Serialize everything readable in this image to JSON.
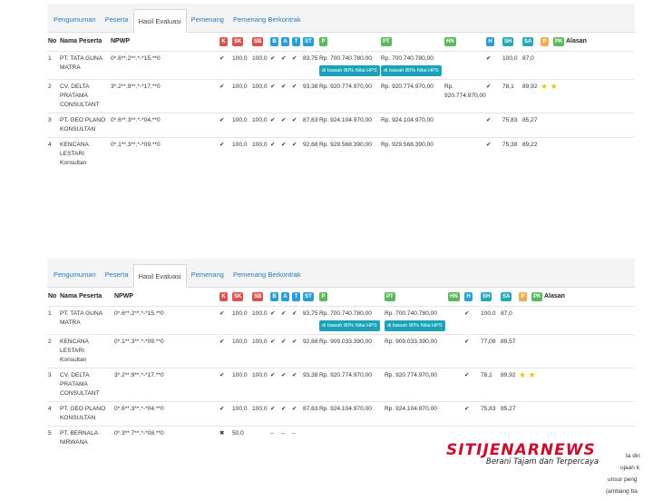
{
  "panels": [
    {
      "tabs": [
        "Pengumuman",
        "Peserta",
        "Hasil Evaluasi",
        "Pemenang",
        "Pemenang Berkontrak"
      ],
      "active_tab": 2,
      "rows": [
        {
          "no": "1",
          "nama": "PT. TATA GUNA MATRA",
          "npwp": "0*.6**.2**.*-*15.**0",
          "k": "✔",
          "sk": "100,0",
          "sb": "100,0",
          "b": "✔",
          "a": "✔",
          "t": "✔",
          "st": "83,75",
          "p": "Rp. 700.740.780,00",
          "pt": "Rp. 700.740.780,00",
          "hn": "",
          "h": "✔",
          "sh": "100,0",
          "sa": "87,0",
          "stars": "",
          "labels": [
            "di bawah 80% Nilai HPS",
            "di bawah 80% Nilai HPS"
          ]
        },
        {
          "no": "2",
          "nama": "CV. DELTA PRATAMA CONSULTANT",
          "npwp": "3*.2**.9**.*-*17.**0",
          "k": "✔",
          "sk": "100,0",
          "sb": "100,0",
          "b": "✔",
          "a": "✔",
          "t": "✔",
          "st": "93,38",
          "p": "Rp. 920.774.970,00",
          "pt": "Rp. 920.774.970,00",
          "hn": "Rp. 920.774.970,00",
          "h": "✔",
          "sh": "78,1",
          "sa": "89,92",
          "stars": "★ ★",
          "labels": []
        },
        {
          "no": "3",
          "nama": "PT. GEO PLANO KONSULTAN",
          "npwp": "0*.6**.3**.*-*04.**0",
          "k": "✔",
          "sk": "100,0",
          "sb": "100,0",
          "b": "✔",
          "a": "✔",
          "t": "✔",
          "st": "87,63",
          "p": "Rp. 924.104.970,00",
          "pt": "Rp. 924.104.970,00",
          "hn": "",
          "h": "✔",
          "sh": "75,83",
          "sa": "85,27",
          "stars": "",
          "labels": []
        },
        {
          "no": "4",
          "nama": "KENCANA LESTARI Konsultan",
          "npwp": "0*.1**.3**.*-*09.**0",
          "k": "✔",
          "sk": "100,0",
          "sb": "100,0",
          "b": "✔",
          "a": "✔",
          "t": "✔",
          "st": "92,68",
          "p": "Rp. 929.568.390,00",
          "pt": "Rp. 929.568.390,00",
          "hn": "",
          "h": "✔",
          "sh": "75,38",
          "sa": "89,22",
          "stars": "",
          "labels": []
        }
      ]
    },
    {
      "tabs": [
        "Pengumuman",
        "Peserta",
        "Hasil Evaluasi",
        "Pemenang",
        "Pemenang Berkontrak"
      ],
      "active_tab": 2,
      "rows": [
        {
          "no": "1",
          "nama": "PT. TATA GUNA MATRA",
          "npwp": "0*.6**.2**.*-*15.**0",
          "k": "✔",
          "sk": "100,0",
          "sb": "100,0",
          "b": "✔",
          "a": "✔",
          "t": "✔",
          "st": "83,75",
          "p": "Rp. 700.740.780,00",
          "pt": "Rp. 700.740.780,00",
          "hn": "",
          "h": "✔",
          "sh": "100,0",
          "sa": "87,0",
          "stars": "",
          "labels": [
            "di bawah 80% Nilai HPS",
            "di bawah 80% Nilai HPS"
          ]
        },
        {
          "no": "2",
          "nama": "KENCANA LESTARI Konsultan",
          "npwp": "0*.1**.3**.*-*09.**0",
          "k": "✔",
          "sk": "100,0",
          "sb": "100,0",
          "b": "✔",
          "a": "✔",
          "t": "✔",
          "st": "92,68",
          "p": "Rp. 909.033.390,00",
          "pt": "Rp. 909.033.390,00",
          "hn": "",
          "h": "✔",
          "sh": "77,09",
          "sa": "89,57",
          "stars": "",
          "labels": []
        },
        {
          "no": "3",
          "nama": "CV. DELTA PRATAMA CONSULTANT",
          "npwp": "3*.2**.9**.*-*17.**0",
          "k": "✔",
          "sk": "100,0",
          "sb": "100,0",
          "b": "✔",
          "a": "✔",
          "t": "✔",
          "st": "93,38",
          "p": "Rp. 920.774.970,00",
          "pt": "Rp. 920.774.970,00",
          "hn": "",
          "h": "✔",
          "sh": "78,1",
          "sa": "89,92",
          "stars": "★ ★",
          "labels": []
        },
        {
          "no": "4",
          "nama": "PT. GEO PLANO KONSULTAN",
          "npwp": "0*.6**.3**.*-*04.**0",
          "k": "✔",
          "sk": "100,0",
          "sb": "100,0",
          "b": "✔",
          "a": "✔",
          "t": "✔",
          "st": "87,63",
          "p": "Rp. 924.104.970,00",
          "pt": "Rp. 924.104.970,00",
          "hn": "",
          "h": "✔",
          "sh": "75,83",
          "sa": "85,27",
          "stars": "",
          "labels": []
        },
        {
          "no": "5",
          "nama": "PT. BERNALA NIRWANA",
          "npwp": "0*.3**.7**.*-*08.**0",
          "k": "✖",
          "sk": "50,0",
          "sb": "",
          "b": "–",
          "a": "–",
          "t": "–",
          "st": "",
          "p": "",
          "pt": "",
          "hn": "",
          "h": "",
          "sh": "",
          "sa": "",
          "stars": "",
          "labels": []
        }
      ]
    }
  ],
  "headers": {
    "no": "No",
    "nama": "Nama Peserta",
    "npwp": "NPWP",
    "k": "K",
    "sk": "SK",
    "sb": "SB",
    "b": "B",
    "a": "A",
    "t": "T",
    "st": "ST",
    "p": "P",
    "pt": "PT",
    "hn": "HN",
    "h": "H",
    "sh": "SH",
    "sa": "SA",
    "pp": "P",
    "pk": "PK",
    "alasan": "Alasan"
  },
  "watermark": {
    "title": "SITIJENARNEWS",
    "subtitle": "Berani Tajam dan Terpercaya"
  },
  "edge_texts": [
    "ta din",
    "ujaan k",
    "unsur peng",
    "(ambang ba"
  ],
  "colors": {
    "red": "#d9534f",
    "blue": "#2b9dd6",
    "green": "#5cb85c",
    "orange": "#f0ad4e",
    "teal": "#1aa3b8",
    "link": "#2a7ab8"
  }
}
